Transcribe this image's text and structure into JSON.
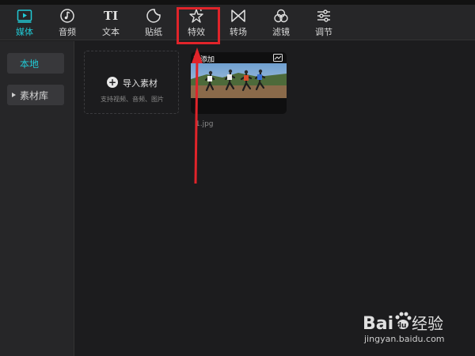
{
  "toolbar": {
    "tabs": [
      {
        "id": "media",
        "label": "媒体",
        "icon": "media-play-icon",
        "active": true
      },
      {
        "id": "audio",
        "label": "音频",
        "icon": "music-note-icon",
        "active": false
      },
      {
        "id": "text",
        "label": "文本",
        "icon": "text-TI-icon",
        "active": false
      },
      {
        "id": "sticker",
        "label": "贴纸",
        "icon": "sticker-icon",
        "active": false
      },
      {
        "id": "effects",
        "label": "特效",
        "icon": "sparkle-star-icon",
        "active": false
      },
      {
        "id": "transition",
        "label": "转场",
        "icon": "bowtie-icon",
        "active": false
      },
      {
        "id": "filter",
        "label": "滤镜",
        "icon": "three-circles-icon",
        "active": false
      },
      {
        "id": "adjust",
        "label": "调节",
        "icon": "sliders-icon",
        "active": false
      }
    ]
  },
  "sidebar": {
    "items": [
      {
        "label": "本地",
        "active": true
      },
      {
        "label": "素材库",
        "active": false
      }
    ]
  },
  "import": {
    "label": "导入素材",
    "sub": "支持视频、音频、图片"
  },
  "media_item": {
    "badge": "已添加",
    "filename": "1.jpg"
  },
  "watermark": {
    "brand": "Bai du 经验",
    "url": "jingyan.baidu.com"
  },
  "colors": {
    "accent": "#21c9d4",
    "highlight": "#e0242a",
    "background": "#1c1c1e",
    "panel": "#262628"
  }
}
